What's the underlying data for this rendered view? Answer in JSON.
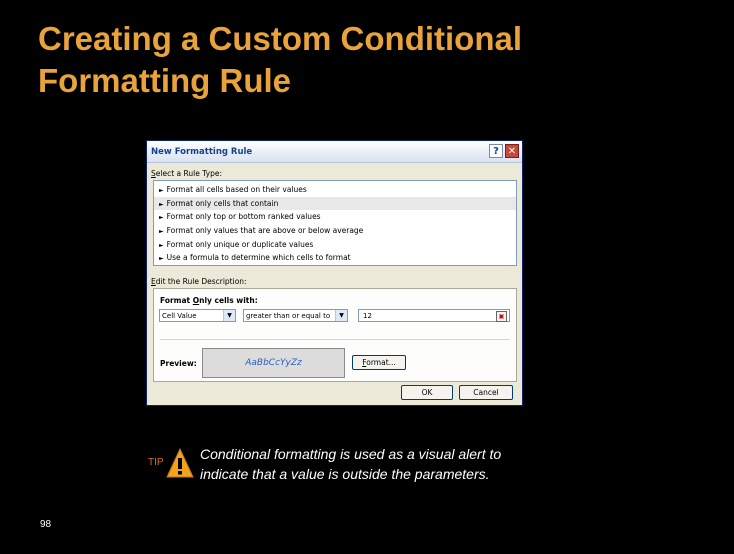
{
  "slide": {
    "title_line1": "Creating a Custom Conditional",
    "title_line2": "Formatting Rule",
    "page_number": "98"
  },
  "dialog": {
    "title": "New Formatting Rule",
    "help_label": "?",
    "close_label": "✕",
    "rule_type_label_u": "S",
    "rule_type_label": "elect a Rule Type:",
    "rule_types": [
      "Format all cells based on their values",
      "Format only cells that contain",
      "Format only top or bottom ranked values",
      "Format only values that are above or below average",
      "Format only unique or duplicate values",
      "Use a formula to determine which cells to format"
    ],
    "selected_rule_index": 1,
    "rule_desc_label_u": "E",
    "rule_desc_label": "dit the Rule Description:",
    "format_cells_with_u": "O",
    "format_cells_with_pre": "Format ",
    "format_cells_with_post": "nly cells with:",
    "condition_type": "Cell Value",
    "operator": "greater than or equal to",
    "value": "12",
    "preview_label": "Preview:",
    "preview_text": "AaBbCcYyZz",
    "format_button_u": "F",
    "format_button": "ormat...",
    "ok_label": "OK",
    "cancel_label": "Cancel"
  },
  "tip": {
    "label": "TIP",
    "line1": "Conditional formatting is used as a visual alert to",
    "line2": "indicate that a value is outside the parameters."
  },
  "colors": {
    "title": "#e8a33a",
    "tip_label": "#e36b1d",
    "warning_icon": "#f2a21c",
    "background": "#000000"
  },
  "icons": {
    "warning": "warning-triangle-icon",
    "dropdown": "chevron-down-icon",
    "range_ref": "collapse-dialog-icon",
    "rule_bullet": "triangle-right-icon"
  }
}
